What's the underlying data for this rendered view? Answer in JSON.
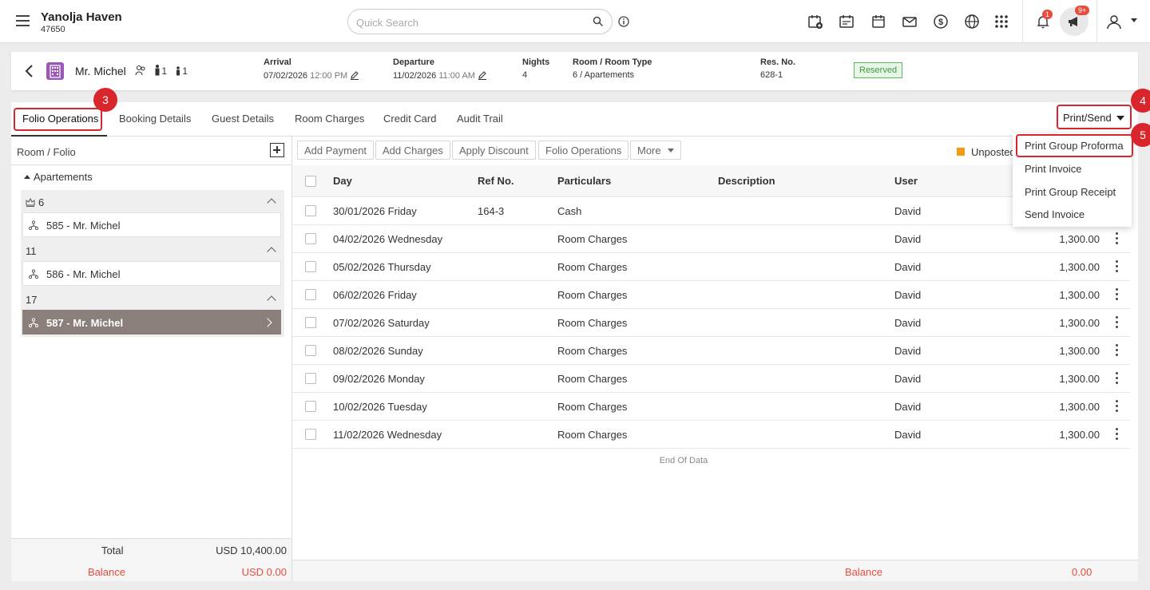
{
  "topbar": {
    "hotel_name": "Yanolja Haven",
    "hotel_id": "47650",
    "search_placeholder": "Quick Search",
    "notification_count": "1",
    "announcement_count": "9+"
  },
  "reservation": {
    "guest_name": "Mr. Michel",
    "adults": "1",
    "children": "1",
    "arrival_label": "Arrival",
    "arrival_date": "07/02/2026",
    "arrival_time": "12:00 PM",
    "departure_label": "Departure",
    "departure_date": "11/02/2026",
    "departure_time": "11:00 AM",
    "nights_label": "Nights",
    "nights": "4",
    "room_label": "Room / Room Type",
    "room_value": "6 / Apartements",
    "res_no_label": "Res. No.",
    "res_no": "628-1",
    "status": "Reserved"
  },
  "tabs": [
    {
      "label": "Folio Operations",
      "active": true
    },
    {
      "label": "Booking Details"
    },
    {
      "label": "Guest Details"
    },
    {
      "label": "Room Charges"
    },
    {
      "label": "Credit Card"
    },
    {
      "label": "Audit Trail"
    }
  ],
  "print_send": {
    "label": "Print/Send",
    "menu": [
      "Print Group Proforma",
      "Print Invoice",
      "Print Group Receipt",
      "Send Invoice"
    ]
  },
  "annotations": [
    "3",
    "4",
    "5"
  ],
  "folio_panel": {
    "title": "Room / Folio",
    "group": "Apartements",
    "rooms": [
      {
        "number": "6",
        "folio": "585 - Mr. Michel"
      },
      {
        "number": "11",
        "folio": "586 - Mr. Michel"
      },
      {
        "number": "17",
        "folio": "587 - Mr. Michel",
        "selected": true
      }
    ],
    "total_label": "Total",
    "total_value": "USD 10,400.00",
    "balance_label": "Balance",
    "balance_value": "USD 0.00"
  },
  "actions": [
    "Add Payment",
    "Add Charges",
    "Apply Discount",
    "Folio Operations",
    "More"
  ],
  "legend_unposted": "Unposted",
  "table": {
    "headers": [
      "Day",
      "Ref No.",
      "Particulars",
      "Description",
      "User"
    ],
    "rows": [
      {
        "day": "30/01/2026 Friday",
        "ref": "164-3",
        "particulars": "Cash",
        "user": "David",
        "amount": ""
      },
      {
        "day": "04/02/2026 Wednesday",
        "ref": "",
        "particulars": "Room Charges",
        "user": "David",
        "amount": "1,300.00"
      },
      {
        "day": "05/02/2026 Thursday",
        "ref": "",
        "particulars": "Room Charges",
        "user": "David",
        "amount": "1,300.00"
      },
      {
        "day": "06/02/2026 Friday",
        "ref": "",
        "particulars": "Room Charges",
        "user": "David",
        "amount": "1,300.00"
      },
      {
        "day": "07/02/2026 Saturday",
        "ref": "",
        "particulars": "Room Charges",
        "user": "David",
        "amount": "1,300.00"
      },
      {
        "day": "08/02/2026 Sunday",
        "ref": "",
        "particulars": "Room Charges",
        "user": "David",
        "amount": "1,300.00"
      },
      {
        "day": "09/02/2026 Monday",
        "ref": "",
        "particulars": "Room Charges",
        "user": "David",
        "amount": "1,300.00"
      },
      {
        "day": "10/02/2026 Tuesday",
        "ref": "",
        "particulars": "Room Charges",
        "user": "David",
        "amount": "1,300.00"
      },
      {
        "day": "11/02/2026 Wednesday",
        "ref": "",
        "particulars": "Room Charges",
        "user": "David",
        "amount": "1,300.00"
      }
    ],
    "end_text": "End Of Data",
    "balance_label": "Balance",
    "balance_value": "0.00"
  }
}
